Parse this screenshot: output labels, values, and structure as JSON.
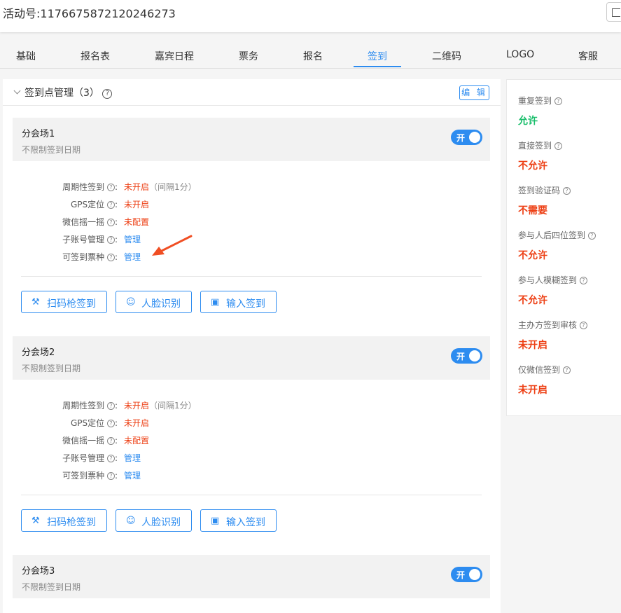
{
  "header": {
    "activity_label": "活动号:1176675872120246273"
  },
  "tabs": [
    {
      "label": "基础"
    },
    {
      "label": "报名表"
    },
    {
      "label": "嘉宾日程"
    },
    {
      "label": "票务"
    },
    {
      "label": "报名"
    },
    {
      "label": "签到",
      "active": true
    },
    {
      "label": "二维码"
    },
    {
      "label": "LOGO"
    },
    {
      "label": "客服"
    }
  ],
  "checkin_panel": {
    "title": "签到点管理（3）",
    "edit_label": "编 辑",
    "switch_label": "开",
    "buttons": {
      "scan": "扫码枪签到",
      "face": "人脸识别",
      "input": "输入签到"
    },
    "venues": [
      {
        "name": "分会场1",
        "date_rule": "不限制签到日期",
        "settings": [
          {
            "key": "周期性签到",
            "value": "未开启",
            "note": "（间隔1分）"
          },
          {
            "key": "GPS定位",
            "value": "未开启"
          },
          {
            "key": "微信摇一摇",
            "value": "未配置"
          },
          {
            "key": "子账号管理",
            "value": "管理"
          },
          {
            "key": "可签到票种",
            "value": "管理"
          }
        ]
      },
      {
        "name": "分会场2",
        "date_rule": "不限制签到日期",
        "settings": [
          {
            "key": "周期性签到",
            "value": "未开启",
            "note": "（间隔1分）"
          },
          {
            "key": "GPS定位",
            "value": "未开启"
          },
          {
            "key": "微信摇一摇",
            "value": "未配置"
          },
          {
            "key": "子账号管理",
            "value": "管理"
          },
          {
            "key": "可签到票种",
            "value": "管理"
          }
        ]
      },
      {
        "name": "分会场3",
        "date_rule": "不限制签到日期"
      }
    ]
  },
  "sidebar": {
    "items": [
      {
        "label": "重复签到",
        "value": "允许",
        "color": "#19be6b"
      },
      {
        "label": "直接签到",
        "value": "不允许",
        "color": "#ed3f14"
      },
      {
        "label": "签到验证码",
        "value": "不需要",
        "color": "#ed3f14"
      },
      {
        "label": "参与人后四位签到",
        "value": "不允许",
        "color": "#ed3f14"
      },
      {
        "label": "参与人模糊签到",
        "value": "不允许",
        "color": "#ed3f14"
      },
      {
        "label": "主办方签到审核",
        "value": "未开启",
        "color": "#ed3f14"
      },
      {
        "label": "仅微信签到",
        "value": "未开启",
        "color": "#ed3f14"
      }
    ]
  },
  "colors": {
    "accent": "#2d8cf0",
    "danger": "#ed3f14",
    "success": "#19be6b"
  }
}
